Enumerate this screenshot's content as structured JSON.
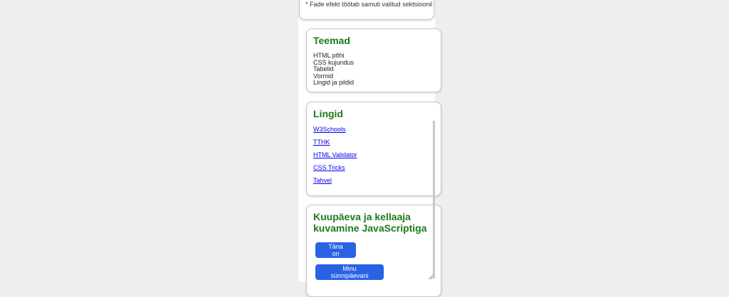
{
  "note": {
    "text": "* Fade efekt töötab samuti valitud sektsioonil"
  },
  "teemad": {
    "title": "Teemad",
    "items": [
      "HTML põhi",
      "CSS kujundus",
      "Tabelid",
      "Vormid",
      "Lingid ja pildid"
    ]
  },
  "lingid": {
    "title": "Lingid",
    "links": [
      "W3Schools",
      "TTHK",
      "HTML Validator",
      "CSS Tricks",
      "Tahvel"
    ]
  },
  "datetime": {
    "title": "Kuupäeva ja kellaaja kuvamine JavaScriptiga",
    "today_button": "Täna on",
    "birthday_button": "Minu sünnipäevani"
  },
  "colors": {
    "heading": "#1b7a1b",
    "button": "#2962e3",
    "link": "#0000ee"
  }
}
